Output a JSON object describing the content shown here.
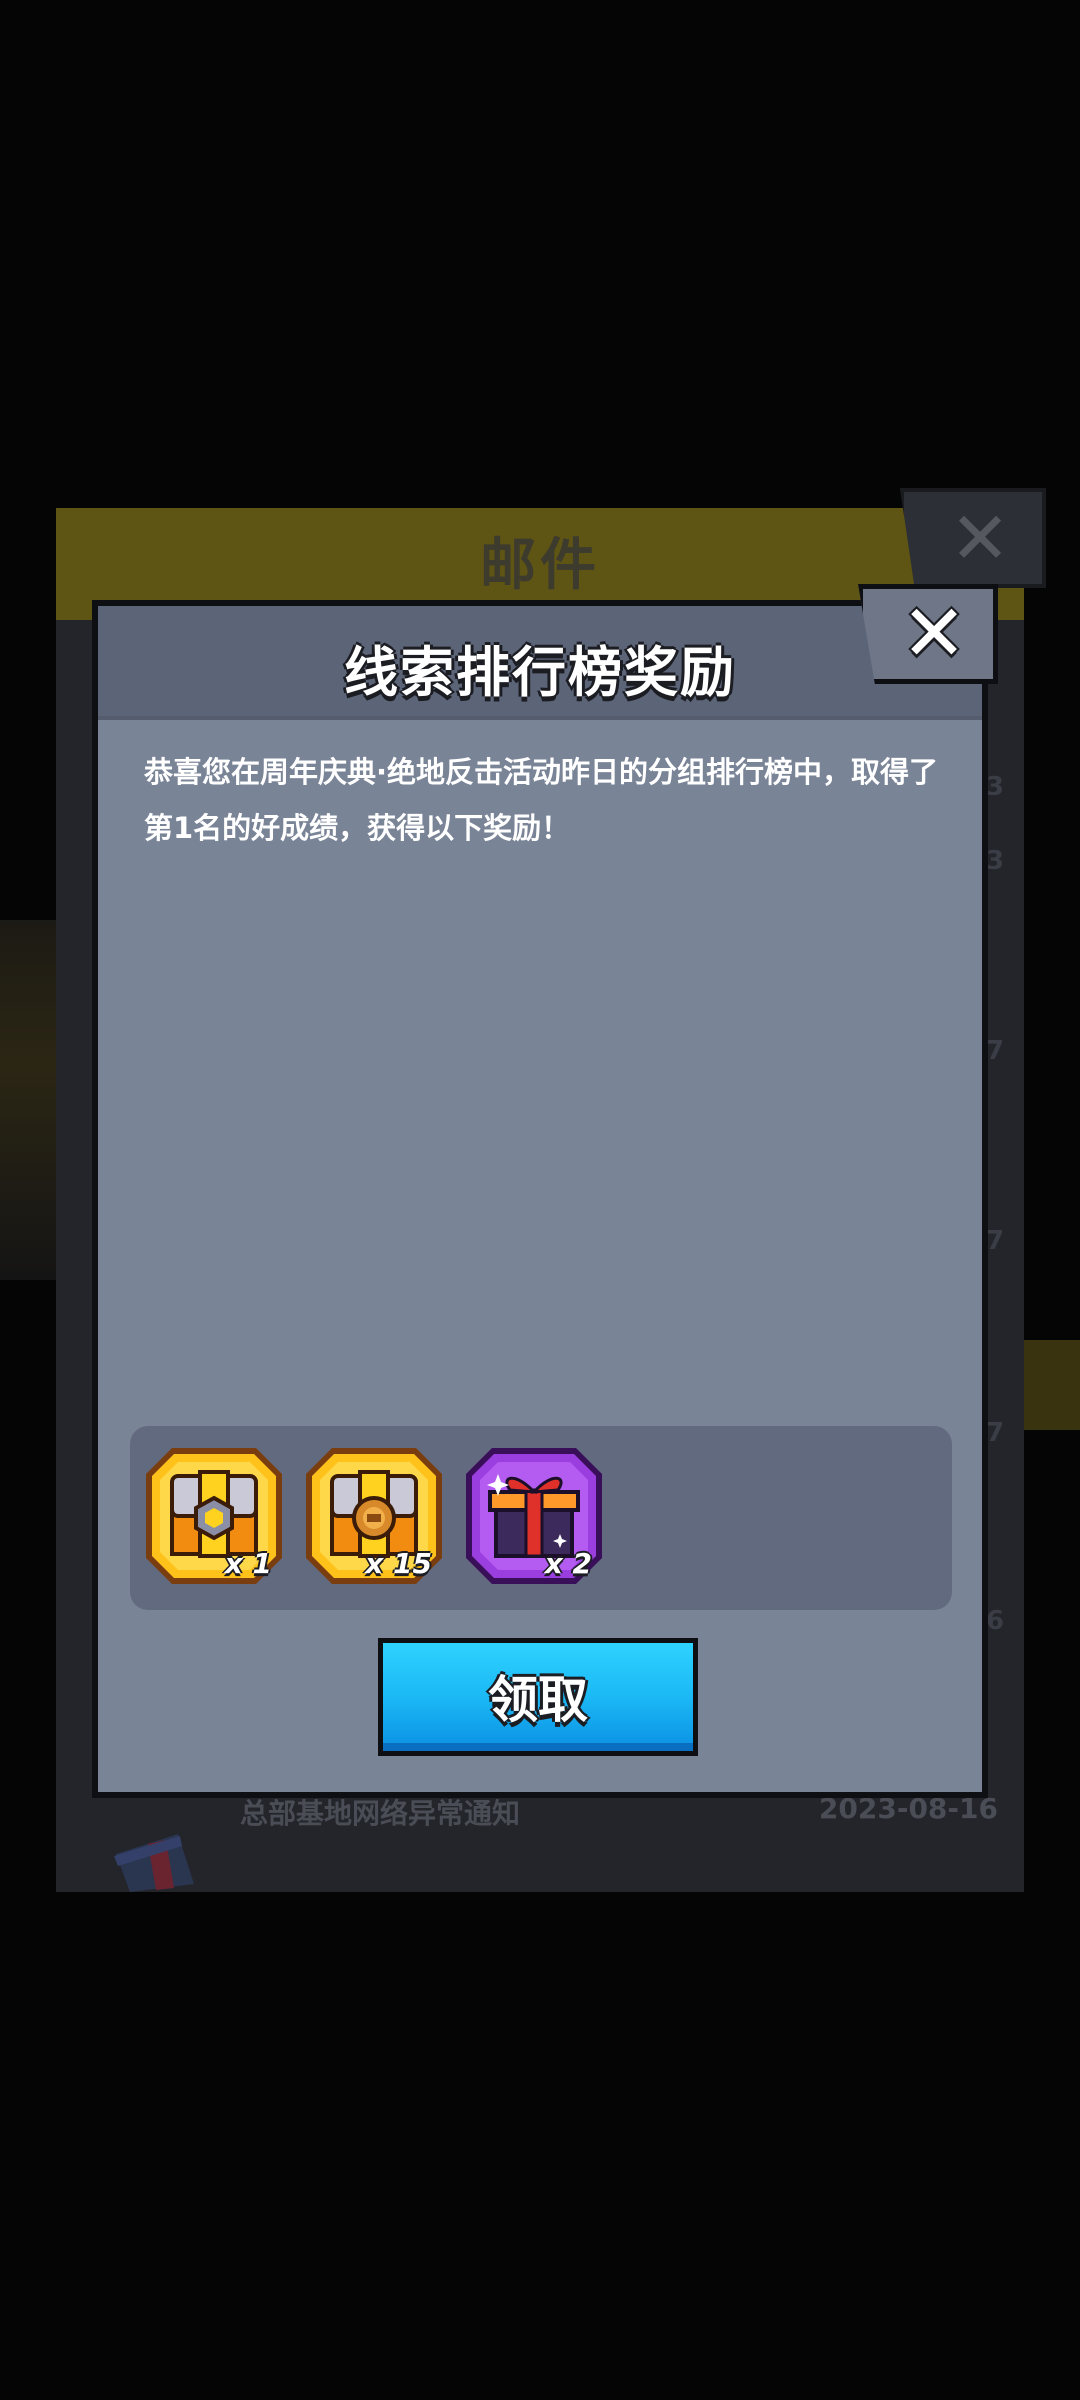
{
  "background": {
    "window_title": "邮件",
    "close_symbol": "✕",
    "list_item": {
      "title": "总部基地网络异常通知",
      "date": "2023-08-16"
    },
    "partial_dates": [
      "3",
      "3",
      "7",
      "7",
      "7",
      "6"
    ]
  },
  "dialog": {
    "title": "线索排行榜奖励",
    "close_symbol": "✕",
    "message": "恭喜您在周年庆典·绝地反击活动昨日的分组排行榜中，取得了第1名的好成绩，获得以下奖励！",
    "rewards": [
      {
        "icon": "gold-chest-hexagon-icon",
        "count": "x 1"
      },
      {
        "icon": "gold-chest-coin-icon",
        "count": "x 15"
      },
      {
        "icon": "purple-gift-box-icon",
        "count": "x 2"
      }
    ],
    "claim_label": "领取"
  },
  "colors": {
    "dialog_bg": "#7a8497",
    "claim_button": "#1bb8f5",
    "reward_gold": "#ffc21a",
    "reward_purple": "#9b3ee0"
  }
}
